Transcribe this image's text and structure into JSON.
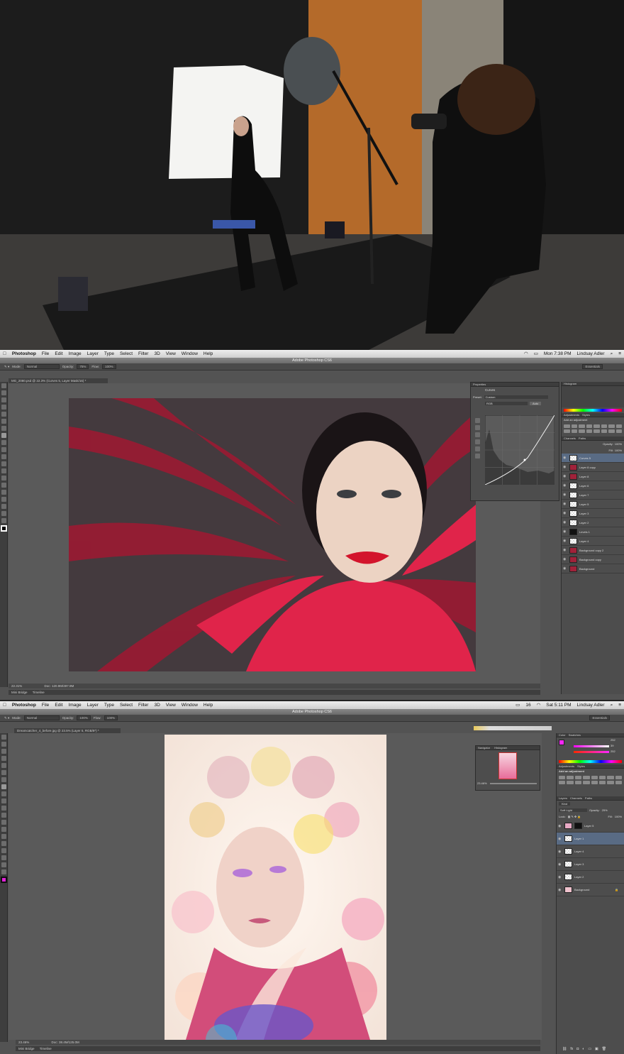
{
  "panel1": {
    "description_hidden": ""
  },
  "ps1": {
    "menu": [
      "Photoshop",
      "File",
      "Edit",
      "Image",
      "Layer",
      "Type",
      "Select",
      "Filter",
      "3D",
      "View",
      "Window",
      "Help"
    ],
    "status_right": [
      "Mon 7:38 PM",
      "Lindsay Adler"
    ],
    "window_title": "Adobe Photoshop CS6",
    "options": {
      "mode_label": "Mode:",
      "mode": "Normal",
      "opacity_label": "Opacity:",
      "opacity": "75%",
      "flow_label": "Flow:",
      "flow": "100%",
      "workspace": "Essentials"
    },
    "doc_tab": "MG_2080.psd @ 22.3% (Curves 5, Layer Mask/16) *",
    "zoom": "22.31%",
    "doc_size": "Doc: 120.9M/497.9M",
    "bottom_tabs": [
      "Mini Bridge",
      "Timeline"
    ],
    "properties": {
      "header": "Properties",
      "type": "Curves",
      "preset_label": "Preset:",
      "preset": "Custom",
      "channel": "RGB",
      "auto": "Auto"
    },
    "panels": {
      "histogram": "Histogram",
      "adjustments": "Adjustments",
      "styles": "Styles",
      "add_adj": "Add an adjustment",
      "channels": "Channels",
      "paths": "Paths",
      "opacity_label": "Opacity:",
      "opacity": "100%",
      "fill_label": "Fill:",
      "fill": "100%"
    },
    "layers": [
      "Curves 5",
      "Layer 8 copy",
      "Layer 8",
      "Layer 6",
      "Layer 7",
      "Layer 5",
      "Layer 3",
      "Layer 2",
      "Levels 1",
      "Layer 4",
      "Background copy 2",
      "Background copy",
      "Background"
    ]
  },
  "ps2": {
    "menu": [
      "Photoshop",
      "File",
      "Edit",
      "Image",
      "Layer",
      "Type",
      "Select",
      "Filter",
      "3D",
      "View",
      "Window",
      "Help"
    ],
    "status_right": [
      "16",
      "Sat 5:11 PM",
      "Lindsay Adler"
    ],
    "window_title": "Adobe Photoshop CS6",
    "options": {
      "mode_label": "Mode:",
      "mode": "Normal",
      "opacity_label": "Opacity:",
      "opacity": "100%",
      "flow_label": "Flow:",
      "flow": "100%",
      "workspace": "Essentials"
    },
    "doc_tab": "Dreamcatcher_4_before.jpg @ 23.5% (Layer 5, RGB/8*) *",
    "zoom": "23.46%",
    "doc_size": "Doc: 38.4M/125.0M",
    "bottom_tabs": [
      "Mini Bridge",
      "Timeline"
    ],
    "navigator": {
      "tabs": [
        "Navigator",
        "Histogram"
      ],
      "zoom": "23.46%"
    },
    "color": {
      "tabs": [
        "Color",
        "Swatches"
      ],
      "r": "252",
      "g": "39",
      "b": "252"
    },
    "adjustments": {
      "tabs": [
        "Adjustments",
        "Styles"
      ],
      "add_adj": "Add an adjustment"
    },
    "layers_panel": {
      "tabs": [
        "Layers",
        "Channels",
        "Paths"
      ],
      "kind": "Kind",
      "blend": "Soft Light",
      "opacity_label": "Opacity:",
      "opacity": "25%",
      "lock_label": "Lock:",
      "fill_label": "Fill:",
      "fill": "100%"
    },
    "layers": [
      "Layer 5",
      "Layer 1",
      "Layer 4",
      "Layer 3",
      "Layer 2",
      "Background"
    ]
  },
  "colors": {
    "selection": "#596b84",
    "panel": "#4d4d4d",
    "canvas_bg": "#5a5a5a"
  }
}
